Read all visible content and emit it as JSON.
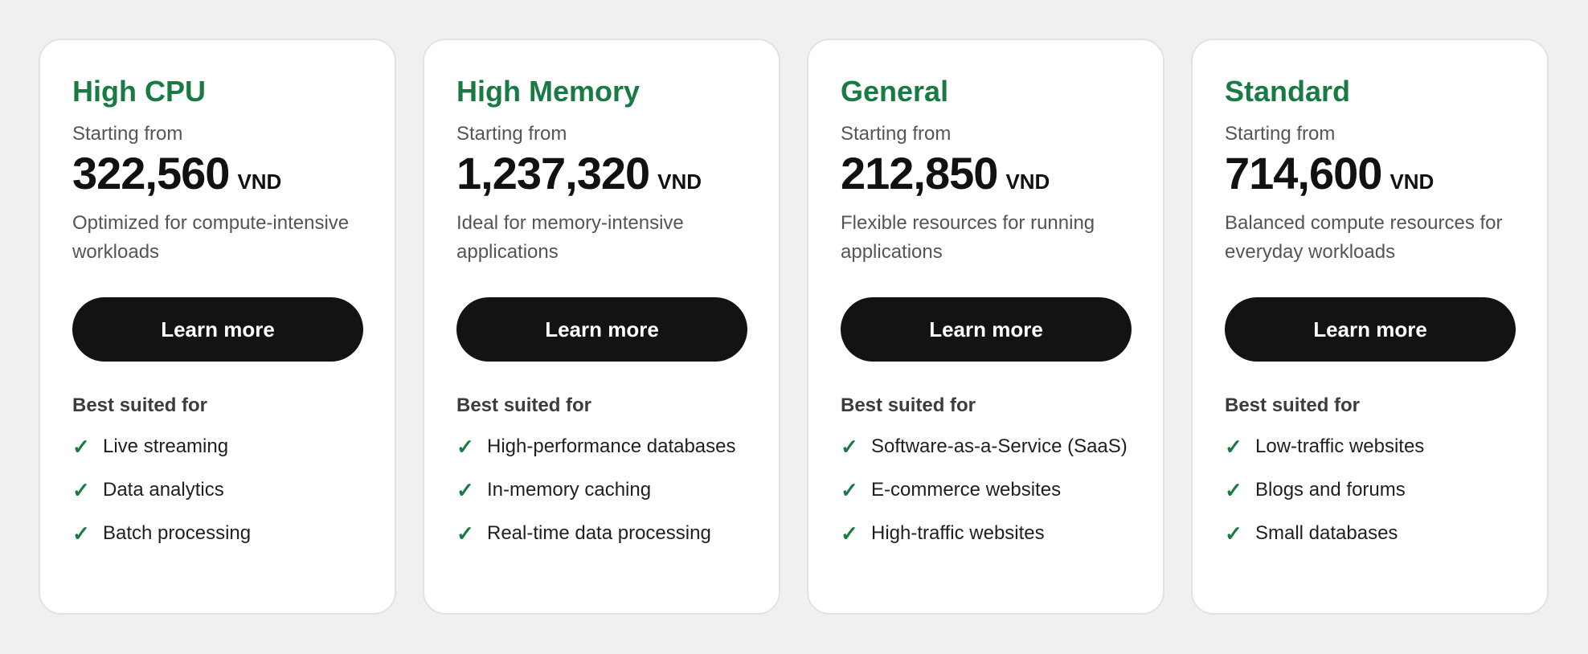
{
  "plans": [
    {
      "name": "High CPU",
      "starting_label": "Starting from",
      "price": "322,560",
      "currency": "VND",
      "description": "Optimized for compute-intensive workloads",
      "cta_label": "Learn more",
      "suited_label": "Best suited for",
      "features": [
        "Live streaming",
        "Data analytics",
        "Batch processing"
      ]
    },
    {
      "name": "High Memory",
      "starting_label": "Starting from",
      "price": "1,237,320",
      "currency": "VND",
      "description": "Ideal for memory-intensive applications",
      "cta_label": "Learn more",
      "suited_label": "Best suited for",
      "features": [
        "High-performance databases",
        "In-memory caching",
        "Real-time data processing"
      ]
    },
    {
      "name": "General",
      "starting_label": "Starting from",
      "price": "212,850",
      "currency": "VND",
      "description": "Flexible resources for running applications",
      "cta_label": "Learn more",
      "suited_label": "Best suited for",
      "features": [
        "Software-as-a-Service (SaaS)",
        "E-commerce websites",
        "High-traffic websites"
      ]
    },
    {
      "name": "Standard",
      "starting_label": "Starting from",
      "price": "714,600",
      "currency": "VND",
      "description": "Balanced compute resources for everyday workloads",
      "cta_label": "Learn more",
      "suited_label": "Best suited for",
      "features": [
        "Low-traffic websites",
        "Blogs and forums",
        "Small databases"
      ]
    }
  ],
  "icons": {
    "check": "check-icon"
  },
  "colors": {
    "accent": "#1a7a43",
    "button": "#131313",
    "background": "#f0f0f0"
  }
}
